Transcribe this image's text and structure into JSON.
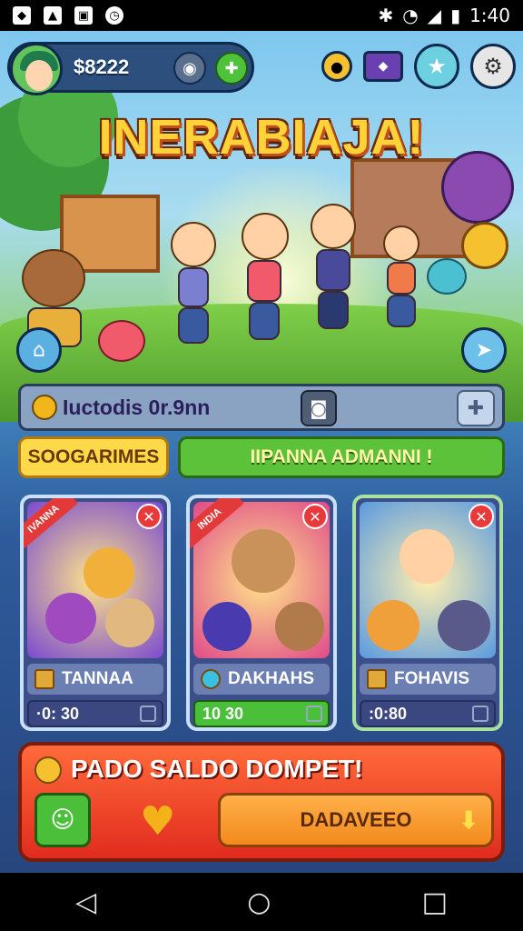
{
  "status_bar": {
    "time": "1:40"
  },
  "hud": {
    "coins": "$8222"
  },
  "title": "INERABIAJA!",
  "quest": {
    "text": "Iuctodis 0r.9nn"
  },
  "tabs": {
    "left": "SOOGARIMES",
    "right": "IIPANNA ADMANNI !"
  },
  "cards": [
    {
      "ribbon": "IVANNA",
      "name": "TANNAA",
      "value": "·0: 30"
    },
    {
      "ribbon": "INDIA",
      "name": "DAKHAHS",
      "value": "10 30"
    },
    {
      "ribbon": "",
      "name": "FOHAVIS",
      "value": ":0:80"
    }
  ],
  "panel": {
    "headline": "PADO SALDO DOMPET!",
    "button": "DADAVEEO"
  },
  "icons": [
    "wifi-icon",
    "bluetooth-icon",
    "battery-icon",
    "star-icon",
    "settings-icon",
    "close-icon",
    "heart-icon",
    "back-icon",
    "home-icon",
    "recent-icon"
  ]
}
